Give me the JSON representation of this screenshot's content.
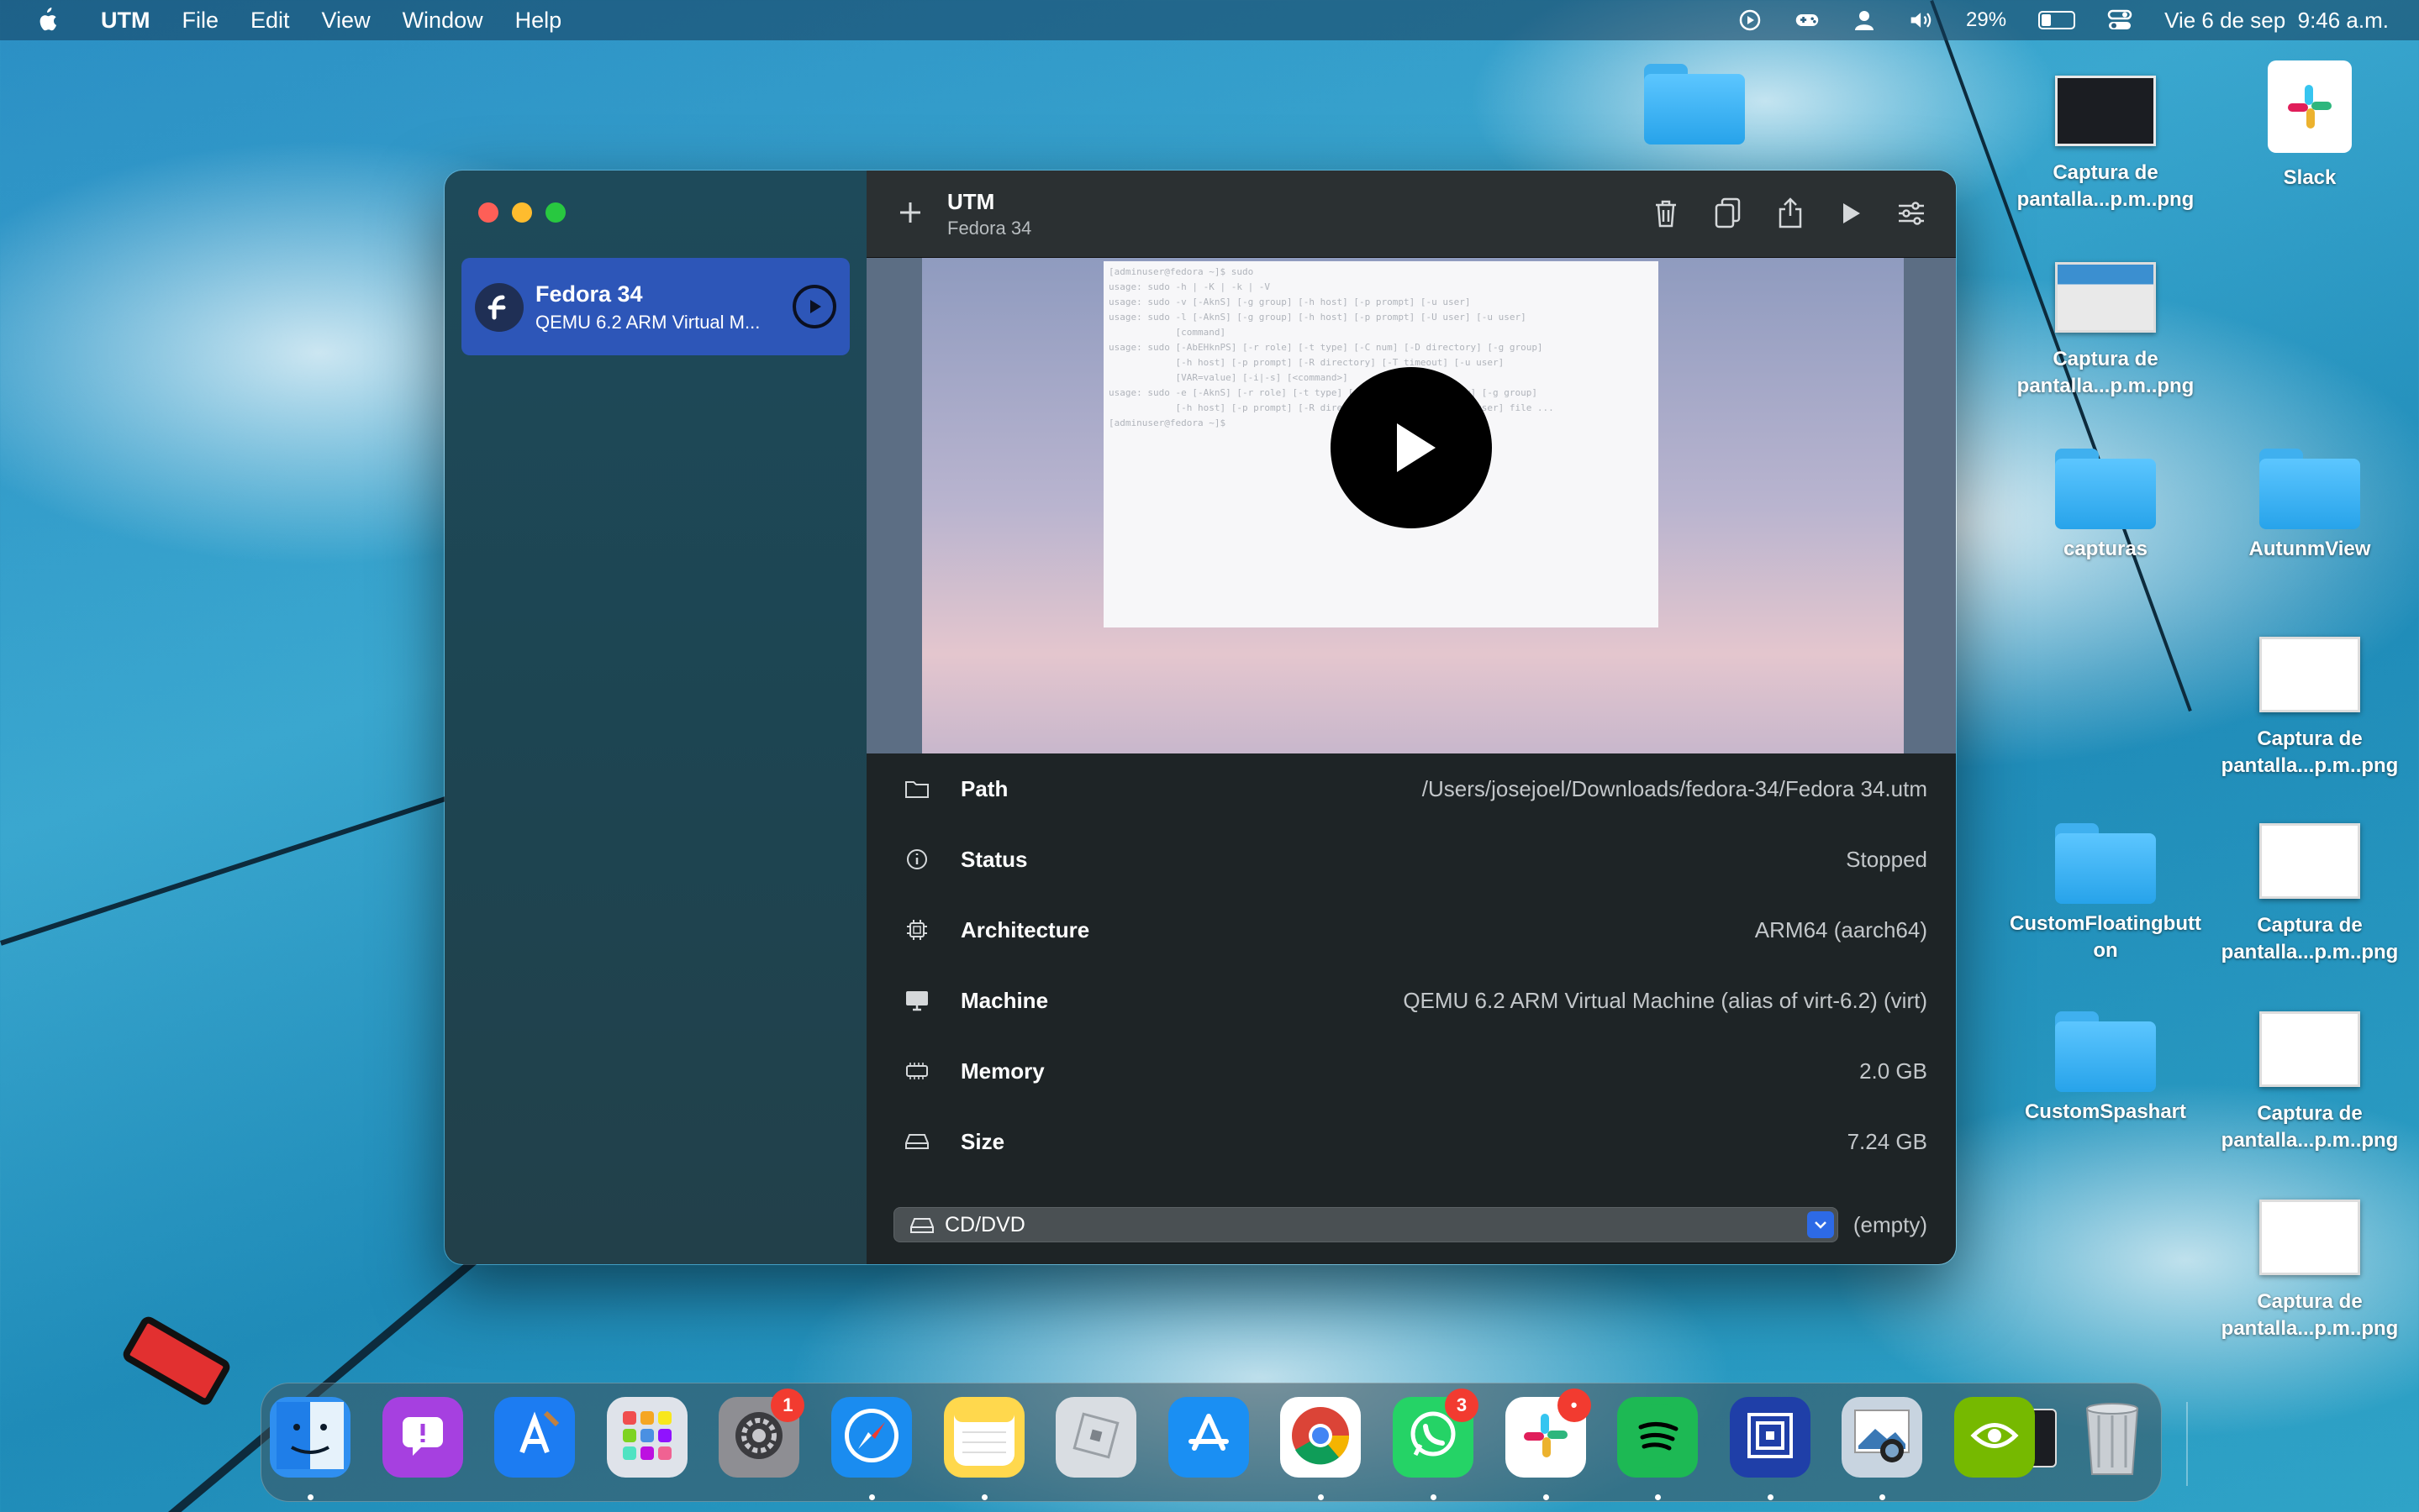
{
  "menubar": {
    "app_name": "UTM",
    "menus": [
      "File",
      "Edit",
      "View",
      "Window",
      "Help"
    ],
    "battery": "29%",
    "battery_level": 0.29,
    "datetime": "Vie 6 de sep  9:46 a.m."
  },
  "window": {
    "toolbar": {
      "title": "UTM",
      "subtitle": "Fedora 34"
    },
    "vm_list": [
      {
        "name": "Fedora 34",
        "subtitle": "QEMU 6.2 ARM Virtual M..."
      }
    ],
    "terminal_lines": [
      "[adminuser@fedora ~]$ sudo",
      "usage: sudo -h | -K | -k | -V",
      "usage: sudo -v [-AknS] [-g group] [-h host] [-p prompt] [-u user]",
      "usage: sudo -l [-AknS] [-g group] [-h host] [-p prompt] [-U user] [-u user]",
      "            [command]",
      "usage: sudo [-AbEHknPS] [-r role] [-t type] [-C num] [-D directory] [-g group]",
      "            [-h host] [-p prompt] [-R directory] [-T timeout] [-u user]",
      "            [VAR=value] [-i|-s] [<command>]",
      "usage: sudo -e [-AknS] [-r role] [-t type] [-C num] [-D directory] [-g group]",
      "            [-h host] [-p prompt] [-R directory] [-T timeout] [-u user] file ...",
      "[adminuser@fedora ~]$ "
    ],
    "details": {
      "path": {
        "label": "Path",
        "value": "/Users/josejoel/Downloads/fedora-34/Fedora 34.utm"
      },
      "status": {
        "label": "Status",
        "value": "Stopped"
      },
      "architecture": {
        "label": "Architecture",
        "value": "ARM64 (aarch64)"
      },
      "machine": {
        "label": "Machine",
        "value": "QEMU 6.2 ARM Virtual Machine (alias of virt-6.2) (virt)"
      },
      "memory": {
        "label": "Memory",
        "value": "2.0 GB"
      },
      "size": {
        "label": "Size",
        "value": "7.24 GB"
      },
      "cd": {
        "label": "CD/DVD",
        "value": "(empty)"
      }
    }
  },
  "desktop": {
    "items": [
      {
        "label": "Captura de pantalla...p.m..png"
      },
      {
        "label": "Slack"
      },
      {
        "label": "Captura de pantalla...p.m..png"
      },
      {
        "label": "capturas"
      },
      {
        "label": "AutunmView"
      },
      {
        "label": "Captura de pantalla...p.m..png"
      },
      {
        "label": "CustomFloatingbutton"
      },
      {
        "label": "Captura de pantalla...p.m..png"
      },
      {
        "label": "CustomSpashart"
      },
      {
        "label": "Captura de pantalla...p.m..png"
      },
      {
        "label": "Captura de pantalla...p.m..png"
      }
    ]
  },
  "dock": {
    "apps": [
      {
        "name": "Finder",
        "icon": "finder-icon",
        "color": "#2f8ff0"
      },
      {
        "name": "Feedback",
        "icon": "feedback-icon",
        "color": "#a640e0"
      },
      {
        "name": "Xcode",
        "icon": "xcode-icon",
        "color": "#1c7cf2"
      },
      {
        "name": "Launchpad",
        "icon": "launchpad-icon",
        "color": "#dfe3ea"
      },
      {
        "name": "System Settings",
        "icon": "settings-icon",
        "color": "#8e8e93",
        "badge": "1"
      },
      {
        "name": "Safari",
        "icon": "safari-icon",
        "color": "#1a8cf0"
      },
      {
        "name": "Notes",
        "icon": "notes-icon",
        "color": "#ffd84d"
      },
      {
        "name": "Roblox",
        "icon": "roblox-icon",
        "color": "#d9dde2"
      },
      {
        "name": "App Store",
        "icon": "appstore-icon",
        "color": "#1a8ff3"
      },
      {
        "name": "Chrome",
        "icon": "chrome-icon",
        "color": "#ffffff"
      },
      {
        "name": "WhatsApp",
        "icon": "whatsapp-icon",
        "color": "#25d366",
        "badge": "3"
      },
      {
        "name": "Slack",
        "icon": "slack-icon",
        "color": "#ffffff",
        "badge": "•"
      },
      {
        "name": "Spotify",
        "icon": "spotify-icon",
        "color": "#1db954"
      },
      {
        "name": "Focusplan",
        "icon": "focus-icon",
        "color": "#1f3fa8"
      },
      {
        "name": "Preview",
        "icon": "preview-icon",
        "color": "#c8d4e0"
      },
      {
        "name": "Nvidia",
        "icon": "nvidia-icon",
        "color": "#76b900"
      }
    ]
  }
}
